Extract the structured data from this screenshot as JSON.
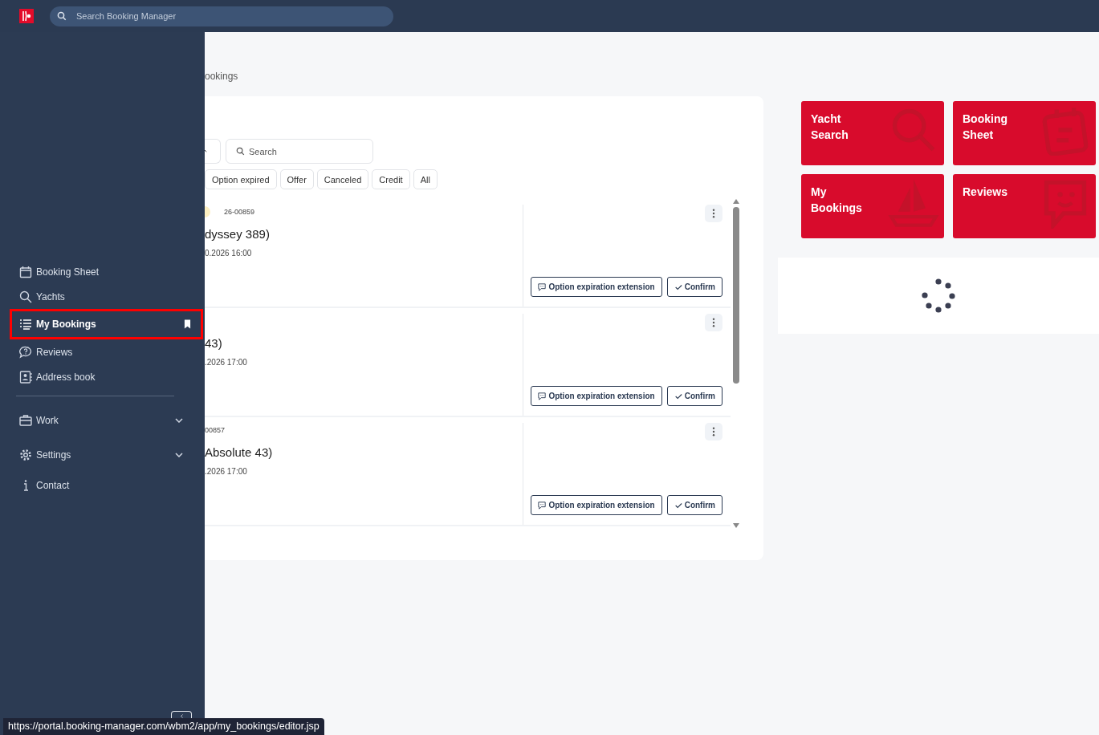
{
  "topbar": {
    "search": {
      "placeholder": "Search Booking Manager"
    }
  },
  "sidebar": {
    "items": [
      {
        "label": "Booking Sheet",
        "selected": false,
        "pinned": false
      },
      {
        "label": "Yachts",
        "selected": false,
        "pinned": false
      },
      {
        "label": "My Bookings",
        "selected": true,
        "pinned": true
      },
      {
        "label": "Reviews",
        "selected": false,
        "pinned": false
      },
      {
        "label": "Address book",
        "selected": false,
        "pinned": false
      }
    ],
    "groups": [
      {
        "label": "Work",
        "expanded": false
      },
      {
        "label": "Settings",
        "expanded": false
      }
    ],
    "contact": "Contact"
  },
  "breadcrumb": "ookings",
  "search": {
    "placeholder": "Search"
  },
  "filters": [
    {
      "label": "Option expired",
      "selected": false
    },
    {
      "label": "Offer",
      "selected": false
    },
    {
      "label": "Canceled",
      "selected": false
    },
    {
      "label": "Credit",
      "selected": false
    },
    {
      "label": "All",
      "selected": false
    }
  ],
  "bookings": [
    {
      "color": "#fdf0c2",
      "number": "26-00859",
      "title": "dyssey 389)",
      "date": "0.2026 16:00",
      "buttons": [
        "Option expiration extension",
        "Confirm"
      ]
    },
    {
      "title": "43)",
      "date": ".2026 17:00",
      "buttons": [
        "Option expiration extension",
        "Confirm"
      ]
    },
    {
      "number": "00857",
      "title": "Absolute 43)",
      "date": ".2026 17:00",
      "buttons": [
        "Option expiration extension",
        "Confirm"
      ]
    }
  ],
  "tiles": [
    {
      "label": "Yacht Search"
    },
    {
      "label": "Booking Sheet"
    },
    {
      "label": "My Bookings"
    },
    {
      "label": "Reviews"
    }
  ],
  "status_url": "https://portal.booking-manager.com/wbm2/app/my_bookings/editor.jsp"
}
